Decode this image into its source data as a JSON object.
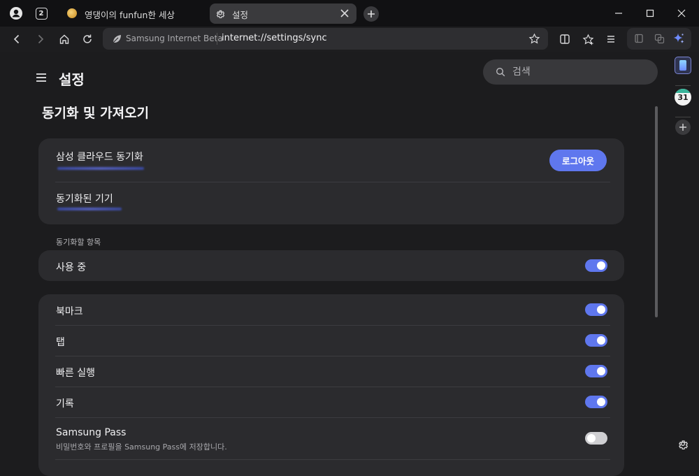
{
  "tabstrip": {
    "tab_count": "2",
    "tabs": [
      {
        "title": "영댕이의 funfun한 세상"
      },
      {
        "title": "설정"
      }
    ]
  },
  "toolbar": {
    "url_scheme_label": "Samsung Internet Beta",
    "url": "internet://settings/sync"
  },
  "sidebar": {
    "calendar_day": "31"
  },
  "settings": {
    "title": "설정",
    "search_placeholder": "검색",
    "section_title": "동기화 및 가져오기",
    "account": {
      "cloud_sync_label": "삼성 클라우드 동기화",
      "logout_label": "로그아웃",
      "synced_devices_label": "동기화된 기기"
    },
    "sync_items_header": "동기화할 항목",
    "in_use": {
      "label": "사용 중",
      "on": true
    },
    "items": [
      {
        "label": "북마크",
        "on": true
      },
      {
        "label": "탭",
        "on": true
      },
      {
        "label": "빠른 실행",
        "on": true
      },
      {
        "label": "기록",
        "on": true
      },
      {
        "label": "Samsung Pass",
        "sub": "비밀번호와 프로필을 Samsung Pass에 저장합니다.",
        "on": false
      }
    ]
  },
  "colors": {
    "accent": "#5f77ee",
    "background": "#1c1c1e",
    "card": "#2b2b2e"
  }
}
